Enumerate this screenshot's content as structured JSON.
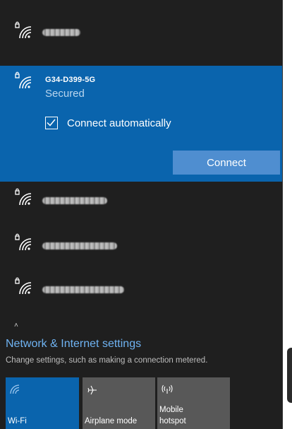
{
  "networks": [
    {
      "name_visible": false
    },
    {
      "name": "G34-D399-5G",
      "status": "Secured",
      "auto_connect_label": "Connect automatically",
      "auto_connect_checked": true,
      "button_label": "Connect"
    },
    {
      "name_visible": false
    },
    {
      "name_visible": false
    },
    {
      "name_visible": false
    }
  ],
  "more_indicator": "˄",
  "settings": {
    "title": "Network & Internet settings",
    "subtitle": "Change settings, such as making a connection metered."
  },
  "quick_actions": {
    "wifi": {
      "label": "Wi-Fi",
      "icon": "wifi-icon",
      "active": true
    },
    "airplane": {
      "label": "Airplane mode",
      "icon": "airplane-icon",
      "active": false
    },
    "hotspot": {
      "label_line1": "Mobile",
      "label_line2": "hotspot",
      "icon": "hotspot-icon",
      "active": false
    }
  },
  "colors": {
    "accent": "#0a64ad",
    "link": "#6fb3f2",
    "background": "#1f1f1f",
    "button": "#4f8ed0",
    "tile_inactive": "#585858"
  }
}
